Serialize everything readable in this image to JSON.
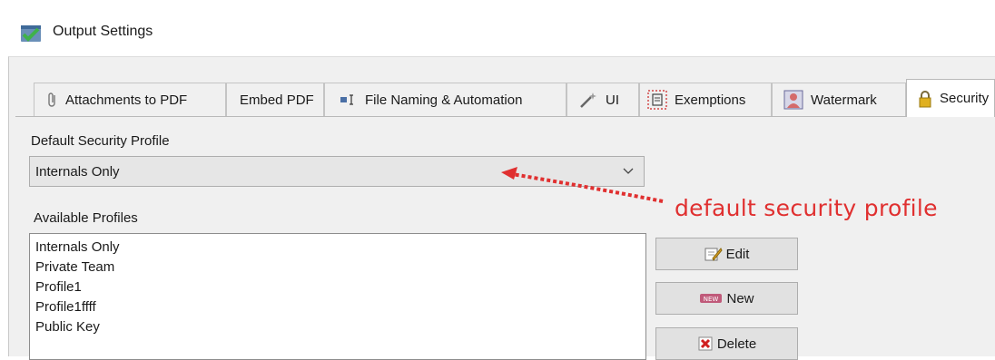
{
  "window": {
    "title": "Output Settings"
  },
  "tabs": [
    {
      "label": "Attachments to PDF",
      "icon": "paperclip-icon"
    },
    {
      "label": "Embed PDF",
      "icon": ""
    },
    {
      "label": "File Naming & Automation",
      "icon": "file-naming-icon"
    },
    {
      "label": "UI",
      "icon": "magic-wand-icon"
    },
    {
      "label": "Exemptions",
      "icon": "exemptions-icon"
    },
    {
      "label": "Watermark",
      "icon": "watermark-icon"
    },
    {
      "label": "Security",
      "icon": "lock-icon",
      "active": true
    }
  ],
  "security": {
    "default_profile_label": "Default Security Profile",
    "default_profile_value": "Internals Only",
    "available_profiles_label": "Available Profiles",
    "profiles": [
      "Internals Only",
      "Private Team",
      "Profile1",
      "Profile1ffff",
      "Public Key"
    ],
    "buttons": {
      "edit": "Edit",
      "new": "New",
      "delete": "Delete"
    }
  },
  "annotation": {
    "text": "default security profile",
    "color": "#e03030"
  },
  "colors": {
    "accent_red": "#e03030",
    "tab_active_bg": "#ffffff",
    "panel_bg": "#f0f0f0"
  }
}
